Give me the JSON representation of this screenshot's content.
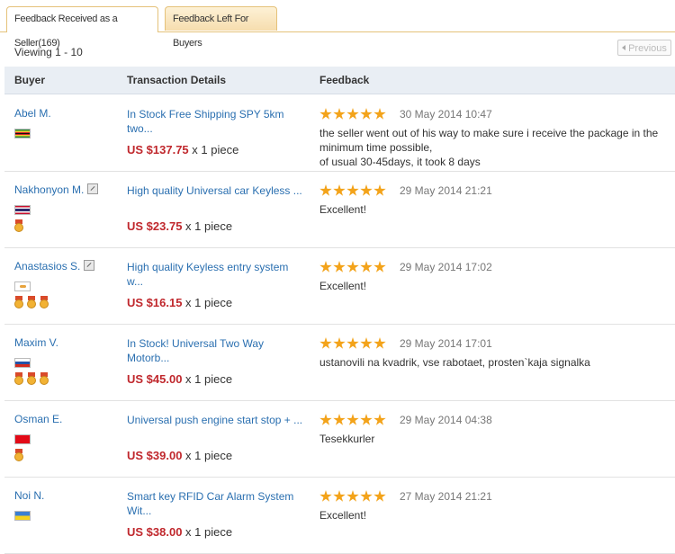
{
  "tabs": [
    {
      "label": "Feedback Received as a Seller(169)",
      "active": true
    },
    {
      "label": "Feedback Left For Buyers",
      "active": false
    }
  ],
  "pagination": {
    "viewing": "Viewing 1 - 10",
    "previous_label": "Previous"
  },
  "columns": {
    "buyer": "Buyer",
    "transaction": "Transaction Details",
    "feedback": "Feedback"
  },
  "colors": {
    "link": "#2a6fb0",
    "price": "#c0282d",
    "star": "#f3a31a",
    "tab_border": "#e5c27a"
  },
  "rows": [
    {
      "buyer": "Abel M.",
      "ext_icon": false,
      "flag": "zimbabwe-flag",
      "medals": 0,
      "item": "In Stock Free Shipping SPY 5km two...",
      "price": "US $137.75",
      "qty": " x 1 piece",
      "stars": 5,
      "date": "30 May 2014 10:47",
      "comment": "the seller went out of his way to make sure i receive the package in the minimum time possible,\nof usual 30-45days, it took 8 days"
    },
    {
      "buyer": "Nakhonyon M.",
      "ext_icon": true,
      "flag": "thailand-flag",
      "medals": 1,
      "item": "High quality Universal car Keyless ...",
      "price": "US $23.75",
      "qty": " x 1 piece",
      "stars": 5,
      "date": "29 May 2014 21:21",
      "comment": "Excellent!"
    },
    {
      "buyer": "Anastasios S.",
      "ext_icon": true,
      "flag": "cyprus-flag",
      "medals": 3,
      "item": "High quality Keyless entry system w...",
      "price": "US $16.15",
      "qty": " x 1 piece",
      "stars": 5,
      "date": "29 May 2014 17:02",
      "comment": "Excellent!"
    },
    {
      "buyer": "Maxim V.",
      "ext_icon": false,
      "flag": "russia-flag",
      "medals": 3,
      "item": "In Stock! Universal Two Way Motorb...",
      "price": "US $45.00",
      "qty": " x 1 piece",
      "stars": 5,
      "date": "29 May 2014 17:01",
      "comment": "ustanovili na kvadrik, vse rabotaet, prosten`kaja signalka"
    },
    {
      "buyer": "Osman E.",
      "ext_icon": false,
      "flag": "turkey-flag",
      "medals": 1,
      "item": "Universal push engine start stop + ...",
      "price": "US $39.00",
      "qty": " x 1 piece",
      "stars": 5,
      "date": "29 May 2014 04:38",
      "comment": "Tesekkurler"
    },
    {
      "buyer": "Noi N.",
      "ext_icon": false,
      "flag": "ukraine-flag",
      "medals": 0,
      "item": "Smart key RFID Car Alarm System Wit...",
      "price": "US $38.00",
      "qty": " x 1 piece",
      "stars": 5,
      "date": "27 May 2014 21:21",
      "comment": "Excellent!"
    }
  ]
}
